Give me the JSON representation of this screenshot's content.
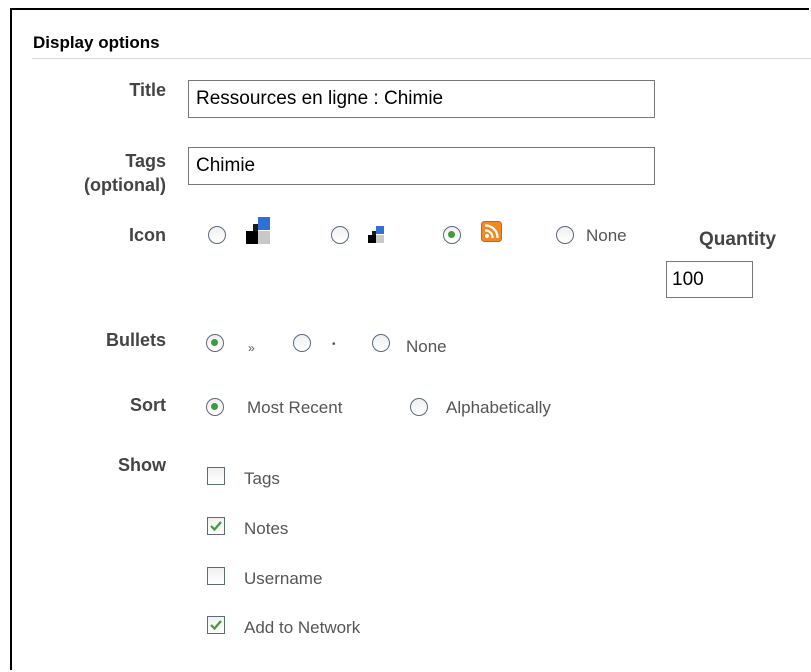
{
  "section": {
    "title": "Display options"
  },
  "title_field": {
    "label": "Title",
    "value": "Ressources en ligne : Chimie"
  },
  "tags_field": {
    "label_line1": "Tags",
    "label_line2": "(optional)",
    "value": "Chimie"
  },
  "icon": {
    "label": "Icon",
    "options": [
      {
        "icon": "large-squares-icon",
        "selected": false
      },
      {
        "icon": "small-squares-icon",
        "selected": false
      },
      {
        "icon": "rss-icon",
        "selected": true
      },
      {
        "label": "None",
        "selected": false
      }
    ]
  },
  "quantity": {
    "label": "Quantity",
    "value": "100"
  },
  "bullets": {
    "label": "Bullets",
    "options": [
      {
        "label": "»",
        "selected": true
      },
      {
        "label": "•",
        "selected": false
      },
      {
        "label": "None",
        "selected": false
      }
    ]
  },
  "sort": {
    "label": "Sort",
    "options": [
      {
        "label": "Most Recent",
        "selected": true
      },
      {
        "label": "Alphabetically",
        "selected": false
      }
    ]
  },
  "show": {
    "label": "Show",
    "options": [
      {
        "label": "Tags",
        "checked": false
      },
      {
        "label": "Notes",
        "checked": true
      },
      {
        "label": "Username",
        "checked": false
      },
      {
        "label": "Add to Network",
        "checked": true
      }
    ]
  },
  "colors": {
    "accent_green": "#3f9a3c",
    "rss_orange": "#f08a24",
    "icon_blue": "#2f6fd6"
  }
}
